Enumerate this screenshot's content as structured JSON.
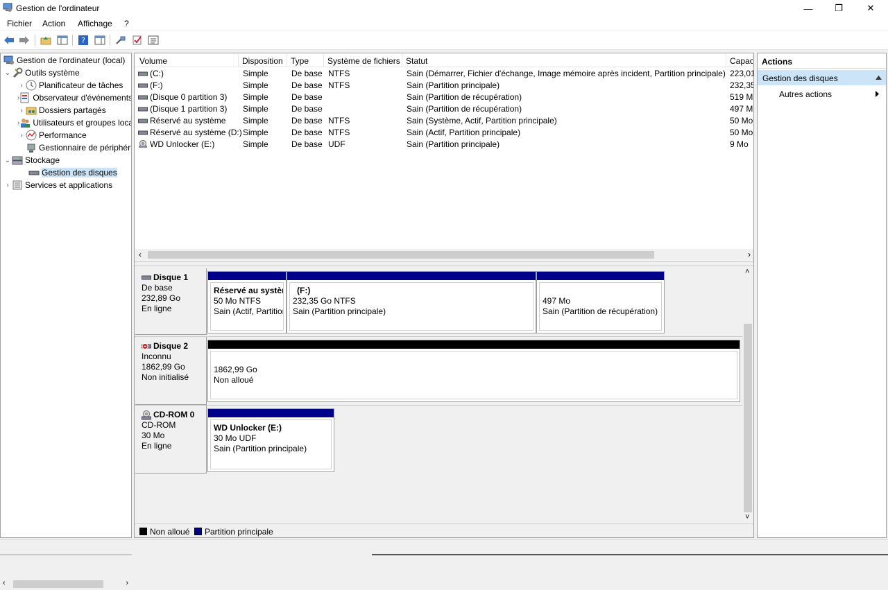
{
  "window": {
    "title": "Gestion de l'ordinateur",
    "minimize": "—",
    "restore": "❐",
    "close": "✕"
  },
  "menu": [
    "Fichier",
    "Action",
    "Affichage",
    "?"
  ],
  "toolbar": {
    "buttons": [
      "back-icon",
      "forward-icon",
      "up-folder-icon",
      "show-hide-tree-icon",
      "help-icon",
      "properties-pane-icon",
      "connect-icon",
      "check-icon",
      "list-icon"
    ]
  },
  "tree": {
    "root": "Gestion de l'ordinateur (local)",
    "items": [
      {
        "label": "Outils système"
      },
      {
        "label": "Planificateur de tâches"
      },
      {
        "label": "Observateur d'événements"
      },
      {
        "label": "Dossiers partagés"
      },
      {
        "label": "Utilisateurs et groupes locaux"
      },
      {
        "label": "Performance"
      },
      {
        "label": "Gestionnaire de périphériques"
      },
      {
        "label": "Stockage"
      },
      {
        "label": "Gestion des disques"
      },
      {
        "label": "Services et applications"
      }
    ]
  },
  "volumes": {
    "columns": [
      "Volume",
      "Disposition",
      "Type",
      "Système de fichiers",
      "Statut",
      "Capac"
    ],
    "rows": [
      [
        "(C:)",
        "Simple",
        "De base",
        "NTFS",
        "Sain (Démarrer, Fichier d'échange, Image mémoire après incident, Partition principale)",
        "223,01"
      ],
      [
        "(F:)",
        "Simple",
        "De base",
        "NTFS",
        "Sain (Partition principale)",
        "232,35"
      ],
      [
        "(Disque 0 partition 3)",
        "Simple",
        "De base",
        "",
        "Sain (Partition de récupération)",
        "519 M"
      ],
      [
        "(Disque 1 partition 3)",
        "Simple",
        "De base",
        "",
        "Sain (Partition de récupération)",
        "497 M"
      ],
      [
        "Réservé au système",
        "Simple",
        "De base",
        "NTFS",
        "Sain (Système, Actif, Partition principale)",
        "50 Mo"
      ],
      [
        "Réservé au système (D:)",
        "Simple",
        "De base",
        "NTFS",
        "Sain (Actif, Partition principale)",
        "50 Mo"
      ],
      [
        "WD Unlocker (E:)",
        "Simple",
        "De base",
        "UDF",
        "Sain (Partition principale)",
        "9 Mo"
      ]
    ]
  },
  "disks": [
    {
      "name": "Disque 1",
      "type": "De base",
      "size": "232,89 Go",
      "status": "En ligne",
      "partitions": [
        {
          "title": "Réservé au système",
          "size": "50 Mo NTFS",
          "status": "Sain (Actif, Partition principale)"
        },
        {
          "title": "(F:)",
          "size": "232,35 Go NTFS",
          "status": "Sain (Partition principale)"
        },
        {
          "title": "",
          "size": "497 Mo",
          "status": "Sain (Partition de récupération)"
        }
      ]
    },
    {
      "name": "Disque 2",
      "type": "Inconnu",
      "size": "1862,99 Go",
      "status": "Non initialisé",
      "partitions": [
        {
          "title": "",
          "size": "1862,99 Go",
          "status": "Non alloué"
        }
      ]
    },
    {
      "name": "CD-ROM 0",
      "type": "CD-ROM",
      "size": "30 Mo",
      "status": "En ligne",
      "partitions": [
        {
          "title": "WD Unlocker  (E:)",
          "size": "30 Mo UDF",
          "status": "Sain (Partition principale)"
        }
      ]
    }
  ],
  "legend": {
    "unallocated": "Non alloué",
    "primary": "Partition principale"
  },
  "actions": {
    "header": "Actions",
    "section": "Gestion des disques",
    "item": "Autres actions"
  },
  "colors": {
    "primary_partition": "#00008b",
    "unallocated": "#000000",
    "selection": "#cce4f7"
  }
}
